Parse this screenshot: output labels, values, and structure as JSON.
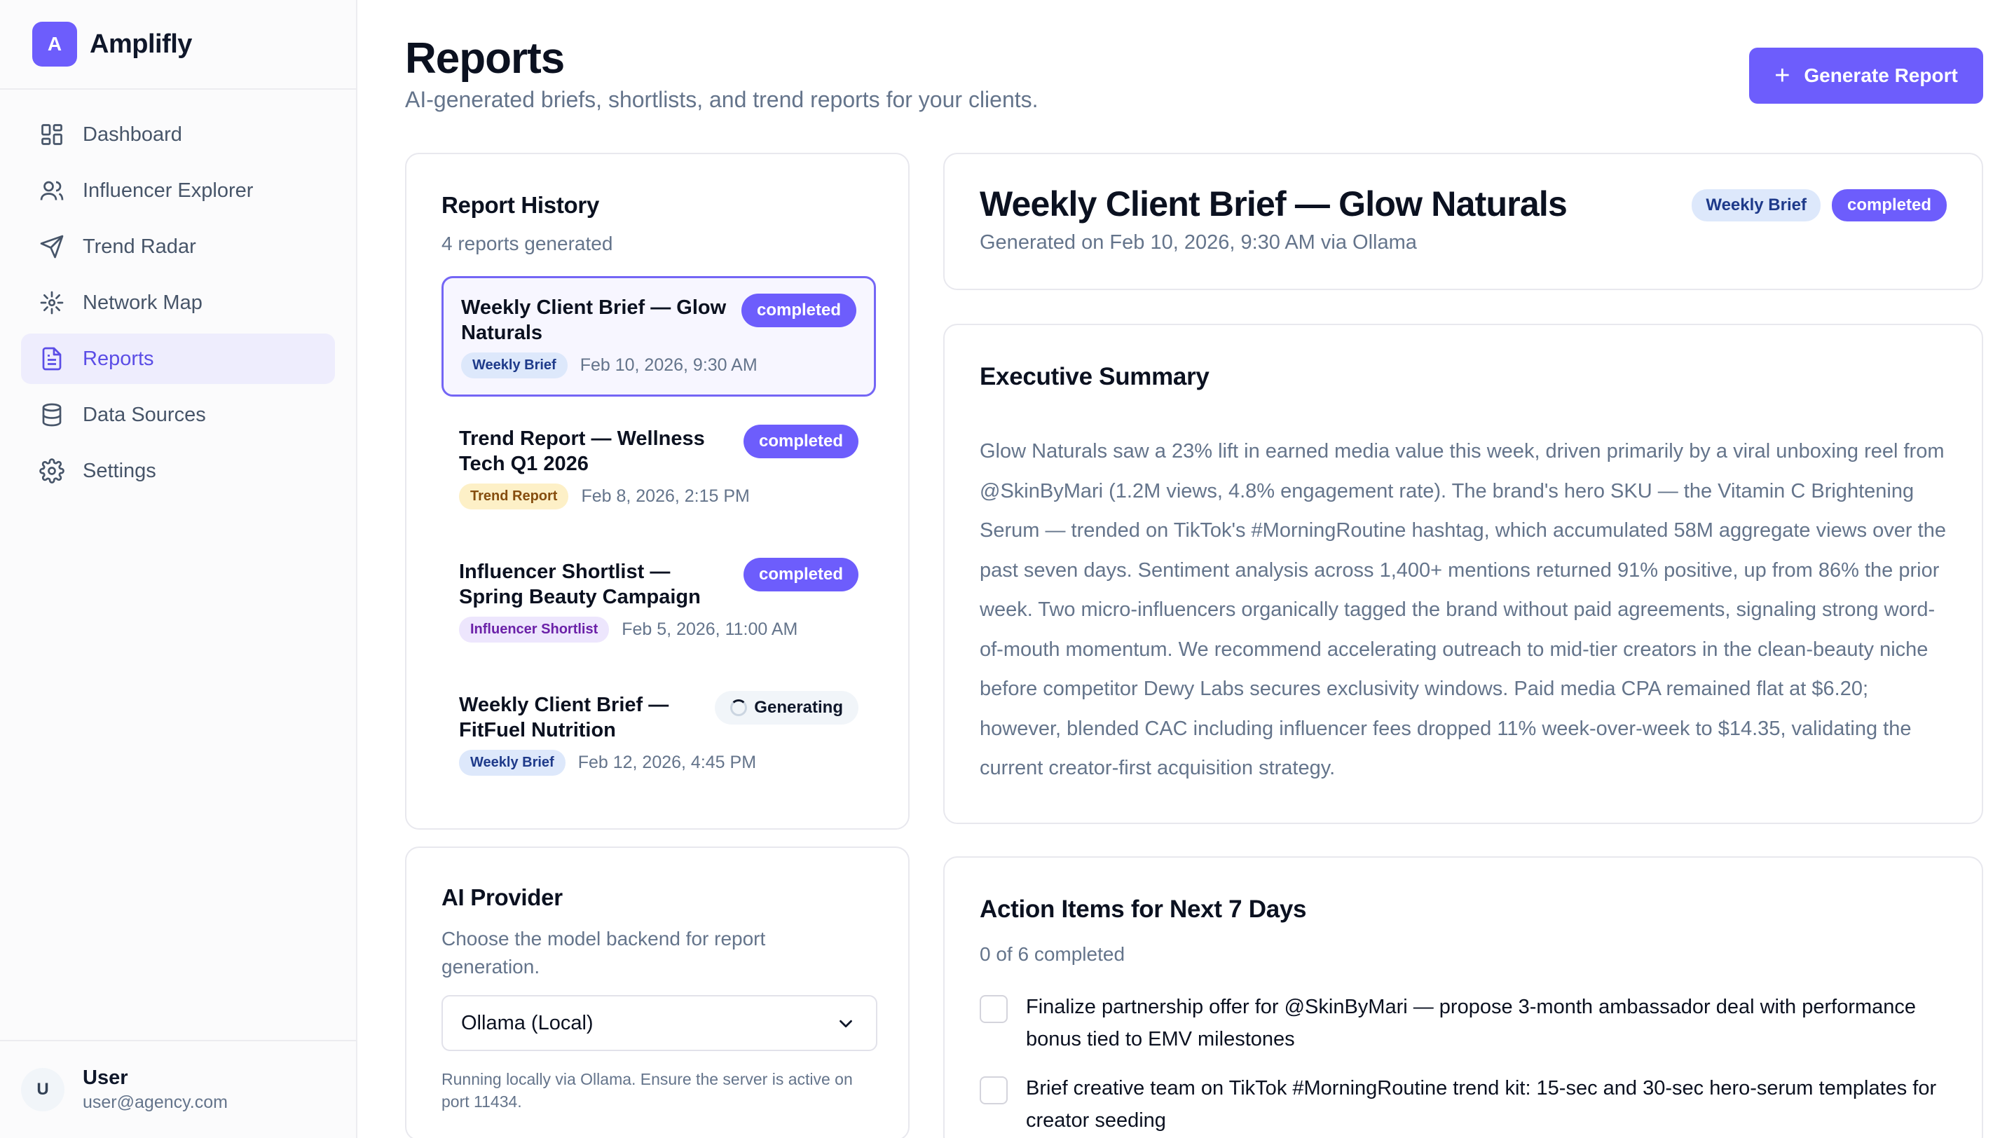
{
  "brand": {
    "logo_letter": "A",
    "name": "Amplifly",
    "accent": "#6d5dfc"
  },
  "nav": [
    {
      "label": "Dashboard",
      "icon": "dashboard-grid-icon",
      "active": false
    },
    {
      "label": "Influencer Explorer",
      "icon": "users-icon",
      "active": false
    },
    {
      "label": "Trend Radar",
      "icon": "send-icon",
      "active": false
    },
    {
      "label": "Network Map",
      "icon": "network-icon",
      "active": false
    },
    {
      "label": "Reports",
      "icon": "file-text-icon",
      "active": true
    },
    {
      "label": "Data Sources",
      "icon": "database-icon",
      "active": false
    },
    {
      "label": "Settings",
      "icon": "gear-icon",
      "active": false
    }
  ],
  "user": {
    "initial": "U",
    "name": "User",
    "email": "user@agency.com"
  },
  "header": {
    "title": "Reports",
    "subtitle": "AI-generated briefs, shortlists, and trend reports for your clients.",
    "generate_label": "Generate Report"
  },
  "history": {
    "title": "Report History",
    "count_text": "4 reports generated",
    "items": [
      {
        "title": "Weekly Client Brief — Glow Naturals",
        "type": "Weekly Brief",
        "date": "Feb 10, 2026, 9:30 AM",
        "status": "completed"
      },
      {
        "title": "Trend Report — Wellness Tech Q1 2026",
        "type": "Trend Report",
        "date": "Feb 8, 2026, 2:15 PM",
        "status": "completed"
      },
      {
        "title": "Influencer Shortlist — Spring Beauty Campaign",
        "type": "Influencer Shortlist",
        "date": "Feb 5, 2026, 11:00 AM",
        "status": "completed"
      },
      {
        "title": "Weekly Client Brief — FitFuel Nutrition",
        "type": "Weekly Brief",
        "date": "Feb 12, 2026, 4:45 PM",
        "status": "Generating"
      }
    ]
  },
  "provider": {
    "title": "AI Provider",
    "description": "Choose the model backend for report generation.",
    "selected": "Ollama (Local)",
    "hint": "Running locally via Ollama. Ensure the server is active on port 11434."
  },
  "report": {
    "title": "Weekly Client Brief — Glow Naturals",
    "generated": "Generated on Feb 10, 2026, 9:30 AM via Ollama",
    "type_badge": "Weekly Brief",
    "status_badge": "completed"
  },
  "summary": {
    "title": "Executive Summary",
    "body": "Glow Naturals saw a 23% lift in earned media value this week, driven primarily by a viral unboxing reel from @SkinByMari (1.2M views, 4.8% engagement rate). The brand's hero SKU — the Vitamin C Brightening Serum — trended on TikTok's #MorningRoutine hashtag, which accumulated 58M aggregate views over the past seven days. Sentiment analysis across 1,400+ mentions returned 91% positive, up from 86% the prior week. Two micro-influencers organically tagged the brand without paid agreements, signaling strong word-of-mouth momentum. We recommend accelerating outreach to mid-tier creators in the clean-beauty niche before competitor Dewy Labs secures exclusivity windows. Paid media CPA remained flat at $6.20; however, blended CAC including influencer fees dropped 11% week-over-week to $14.35, validating the current creator-first acquisition strategy."
  },
  "actions": {
    "title": "Action Items for Next 7 Days",
    "progress": "0 of 6 completed",
    "items": [
      {
        "text": "Finalize partnership offer for @SkinByMari — propose 3-month ambassador deal with performance bonus tied to EMV milestones",
        "checked": false
      },
      {
        "text": "Brief creative team on TikTok #MorningRoutine trend kit: 15-sec and 30-sec hero-serum templates for creator seeding",
        "checked": false
      }
    ]
  }
}
